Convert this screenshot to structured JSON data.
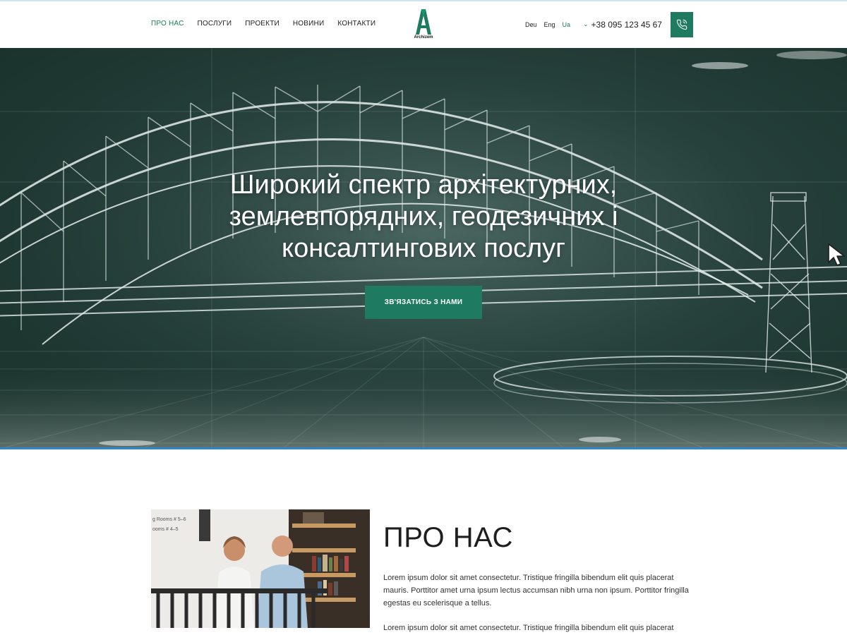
{
  "header": {
    "nav": [
      {
        "label": "ПРО НАС",
        "active": true
      },
      {
        "label": "ПОСЛУГИ",
        "active": false
      },
      {
        "label": "ПРОЕКТИ",
        "active": false
      },
      {
        "label": "НОВИНИ",
        "active": false
      },
      {
        "label": "КОНТАКТИ",
        "active": false
      }
    ],
    "logo_text": "Archizem",
    "languages": [
      {
        "label": "Deu",
        "active": false
      },
      {
        "label": "Eng",
        "active": false
      },
      {
        "label": "Ua",
        "active": true
      }
    ],
    "phone": "+38 095 123 45 67",
    "call_icon": "phone-icon"
  },
  "hero": {
    "title_line1": "Широкий спектр архітектурних,",
    "title_line2": "землевпорядних, геодезичних і",
    "title_line3": "консалтингових послуг",
    "cta_label": "ЗВ'ЯЗАТИСЬ З НАМИ"
  },
  "about": {
    "title": "ПРО НАС",
    "paragraph1": "Lorem ipsum dolor sit amet consectetur. Tristique fringilla bibendum elit quis placerat mauris. Porttitor amet urna ipsum lectus accumsan nibh urna non ipsum. Porttitor fringilla egestas eu scelerisque a tellus.",
    "paragraph2": "Lorem ipsum dolor sit amet consectetur. Tristique fringilla bibendum elit quis placerat",
    "photo_sign_line1": "g Rooms # 5–6",
    "photo_sign_line2": "ooms # 4–5"
  },
  "colors": {
    "accent": "#1e7a60",
    "hero_bg": "#26403b",
    "text": "#1e1e1e",
    "divider": "#2f86c8"
  }
}
